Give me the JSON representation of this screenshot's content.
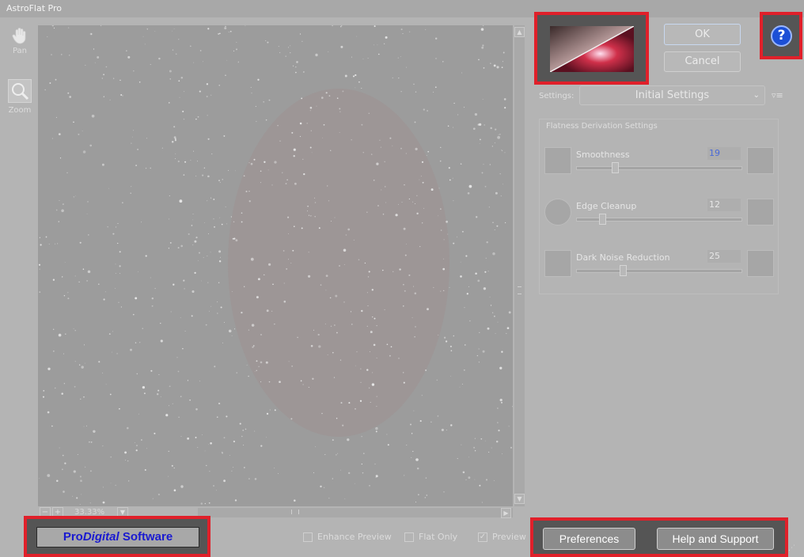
{
  "window": {
    "title": "AstroFlat Pro"
  },
  "tools": {
    "pan_label": "Pan",
    "zoom_label": "Zoom"
  },
  "zoom": {
    "level": "33.33%"
  },
  "buttons": {
    "ok": "OK",
    "cancel": "Cancel",
    "help_glyph": "?"
  },
  "settings": {
    "label": "Settings:",
    "selected": "Initial Settings"
  },
  "flatness": {
    "title": "Flatness Derivation Settings",
    "sliders": [
      {
        "label": "Smoothness",
        "value": "19",
        "level": 0.22
      },
      {
        "label": "Edge Cleanup",
        "value": "12",
        "level": 0.14
      },
      {
        "label": "Dark Noise Reduction",
        "value": "25",
        "level": 0.27
      }
    ]
  },
  "brand": {
    "part1": "Pro",
    "part2": "Digital",
    "part3": " Software"
  },
  "checkboxes": {
    "enhance_preview": "Enhance Preview",
    "flat_only": "Flat Only",
    "preview": "Preview",
    "preview_checked": true
  },
  "bottom_buttons": {
    "preferences": "Preferences",
    "help_support": "Help and Support"
  },
  "colors": {
    "highlight": "#e0202a",
    "help_icon": "#1c4fd6",
    "brand_text": "#1a1ad0"
  },
  "icons": {
    "pan": "hand-icon",
    "zoom": "magnifier-icon"
  }
}
